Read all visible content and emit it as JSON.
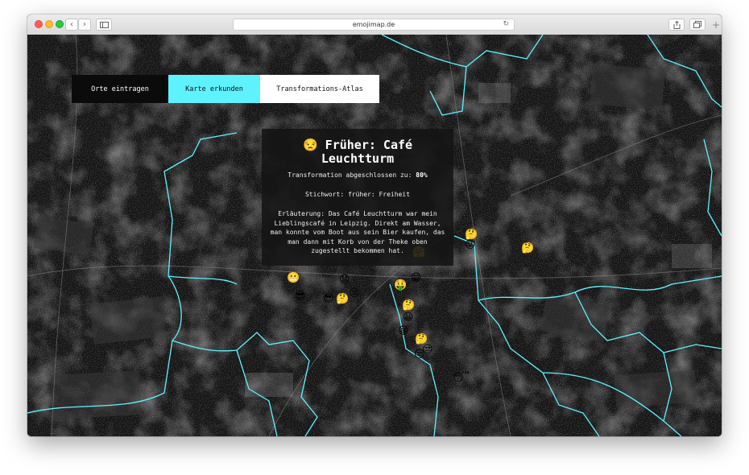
{
  "browser": {
    "url": "emojimap.de",
    "back_icon": "chevron-left-icon",
    "forward_icon": "chevron-right-icon",
    "sidebar_icon": "sidebar-icon",
    "reload_icon": "reload-icon",
    "share_icon": "share-icon",
    "tabs_icon": "tabs-icon",
    "new_tab_icon": "plus-icon"
  },
  "nav": {
    "items": [
      {
        "label": "Orte eintragen"
      },
      {
        "label": "Karte erkunden"
      },
      {
        "label": "Transformations-Atlas"
      }
    ],
    "active_color": "#5ef2ff"
  },
  "popup": {
    "emoji": "😒",
    "title": "Früher: Café Leuchtturm",
    "transformation_label": "Transformation abgeschlossen zu:",
    "transformation_value": "80%",
    "keyword": "Stichwort: früher: Freiheit",
    "description": "Erläuterung: Das Café Leuchtturm war mein Lieblingscafé in Leipzig. Direkt am Wasser, man konnte vom Boot aus sein Bier kaufen, das man dann mit Korb von der Theke oben zugestellt bekommen hat."
  },
  "map": {
    "boundary_color": "#5ef2ff",
    "markers": [
      {
        "emoji": "🤔"
      },
      {
        "emoji": "😡"
      },
      {
        "emoji": "🤔"
      },
      {
        "emoji": "🤗"
      },
      {
        "emoji": "😁"
      },
      {
        "emoji": "🤤"
      },
      {
        "emoji": "😬"
      },
      {
        "emoji": "😟"
      },
      {
        "emoji": "😎"
      },
      {
        "emoji": "😎"
      },
      {
        "emoji": "🤔"
      },
      {
        "emoji": "😒"
      },
      {
        "emoji": "🤑"
      },
      {
        "emoji": "😀"
      },
      {
        "emoji": "🤔"
      },
      {
        "emoji": "😀"
      },
      {
        "emoji": "🤔"
      },
      {
        "emoji": "😒"
      },
      {
        "emoji": "😒"
      },
      {
        "emoji": "😴"
      }
    ]
  }
}
